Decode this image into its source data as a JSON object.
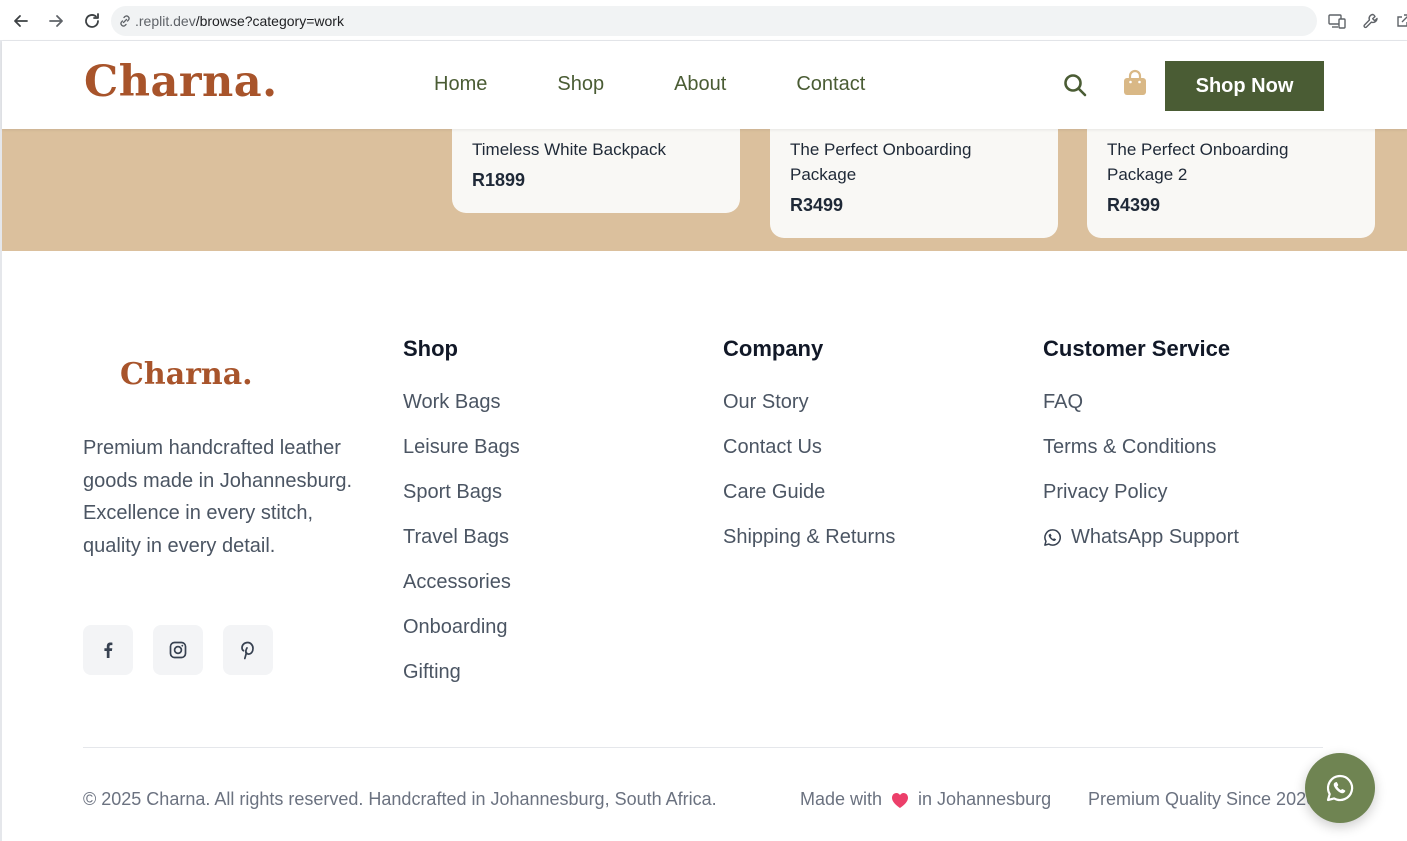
{
  "browser": {
    "url_host": ".replit.dev",
    "url_path": "/browse?category=work"
  },
  "header": {
    "logo": "Charna.",
    "nav": [
      "Home",
      "Shop",
      "About",
      "Contact"
    ],
    "cta_label": "Shop Now"
  },
  "products": [
    {
      "name": "Timeless White Backpack",
      "price": "R1899"
    },
    {
      "name": "The Perfect Onboarding Package",
      "price": "R3499"
    },
    {
      "name": "The Perfect Onboarding Package 2",
      "price": "R4399"
    }
  ],
  "footer": {
    "logo": "Charna.",
    "description": "Premium handcrafted leather goods made in Johannesburg. Excellence in every stitch, quality in every detail.",
    "social": [
      "facebook-icon",
      "instagram-icon",
      "pinterest-icon"
    ],
    "columns": [
      {
        "title": "Shop",
        "links": [
          "Work Bags",
          "Leisure Bags",
          "Sport Bags",
          "Travel Bags",
          "Accessories",
          "Onboarding",
          "Gifting"
        ]
      },
      {
        "title": "Company",
        "links": [
          "Our Story",
          "Contact Us",
          "Care Guide",
          "Shipping & Returns"
        ]
      },
      {
        "title": "Customer Service",
        "links": [
          "FAQ",
          "Terms & Conditions",
          "Privacy Policy",
          "WhatsApp Support"
        ]
      }
    ],
    "copyright": "© 2025 Charna. All rights reserved. Handcrafted in Johannesburg, South Africa.",
    "made_with_prefix": "Made with",
    "made_with_suffix": "in Johannesburg",
    "premium": "Premium Quality Since 2020"
  },
  "colors": {
    "brand": "#a8542b",
    "olive": "#4a5c34",
    "sand": "#dbc09d",
    "whatsapp_float": "#6f8452"
  }
}
